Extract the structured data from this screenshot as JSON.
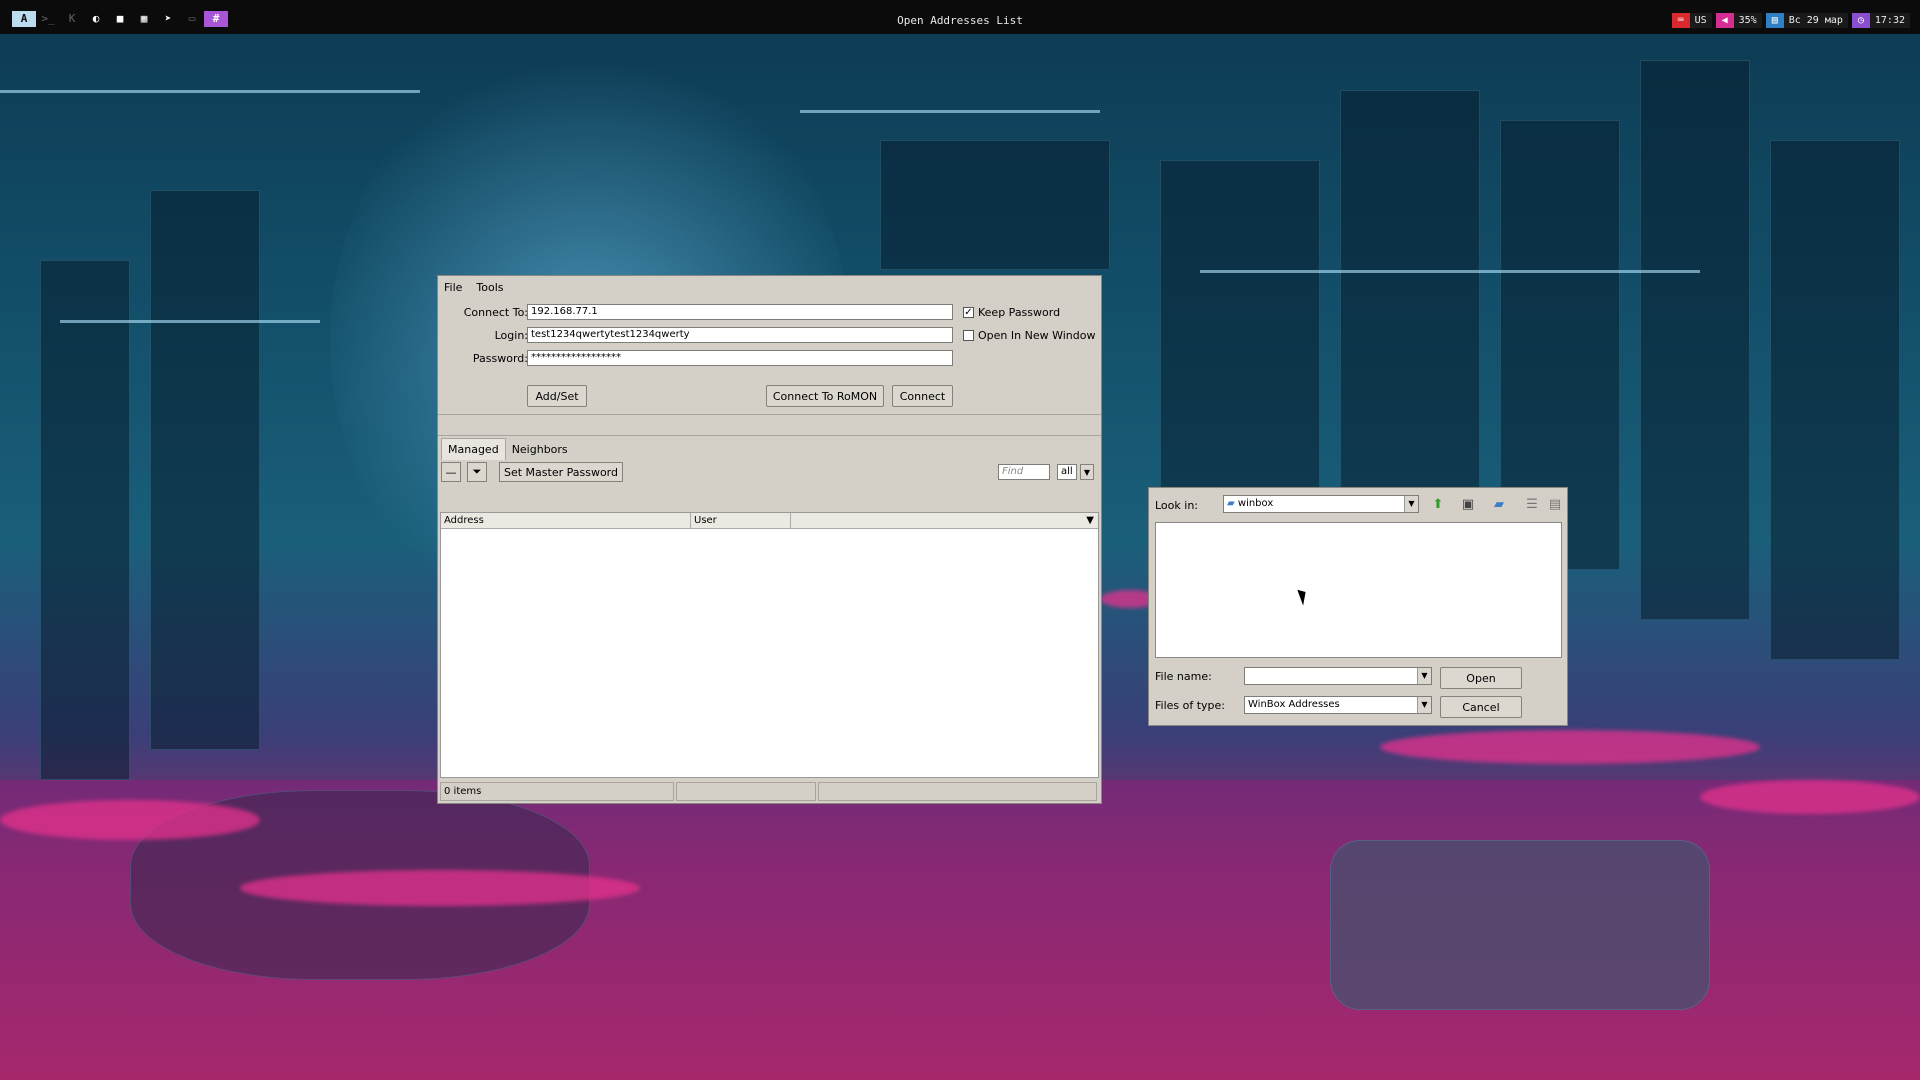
{
  "topbar": {
    "title": "Open Addresses List",
    "workspace_icons": [
      {
        "name": "app-launcher-icon",
        "glyph": "A"
      },
      {
        "name": "terminal-icon",
        "glyph": ">_"
      },
      {
        "name": "code-icon",
        "glyph": "K"
      },
      {
        "name": "browser-icon",
        "glyph": "◐"
      },
      {
        "name": "folder-icon",
        "glyph": "■"
      },
      {
        "name": "film-icon",
        "glyph": "▦"
      },
      {
        "name": "telegram-icon",
        "glyph": "➤"
      },
      {
        "name": "image-icon",
        "glyph": "▭"
      },
      {
        "name": "hash-icon",
        "glyph": "#"
      }
    ],
    "keyboard_layout": "US",
    "volume": "35%",
    "date": "Вс 29 мар",
    "time": "17:32"
  },
  "winbox": {
    "menu": {
      "file": "File",
      "tools": "Tools"
    },
    "connect_to_label": "Connect To:",
    "connect_to_value": "192.168.77.1",
    "login_label": "Login:",
    "login_value": "test1234qwertytest1234qwerty",
    "password_label": "Password:",
    "password_value": "******************",
    "keep_password_label": "Keep Password",
    "keep_password_checked": true,
    "new_window_label": "Open In New Window",
    "new_window_checked": false,
    "add_set_label": "Add/Set",
    "connect_romon_label": "Connect To RoMON",
    "connect_label": "Connect",
    "tabs": [
      "Managed",
      "Neighbors"
    ],
    "set_master_password_label": "Set Master Password",
    "find_placeholder": "Find",
    "filter_value": "all",
    "columns": [
      "Address",
      "User"
    ],
    "status_items": "0 items"
  },
  "dialog": {
    "look_in_label": "Look in:",
    "look_in_value": "winbox",
    "file_name_label": "File name:",
    "file_name_value": "",
    "files_of_type_label": "Files of type:",
    "files_of_type_value": "WinBox Addresses",
    "open_label": "Open",
    "cancel_label": "Cancel"
  }
}
